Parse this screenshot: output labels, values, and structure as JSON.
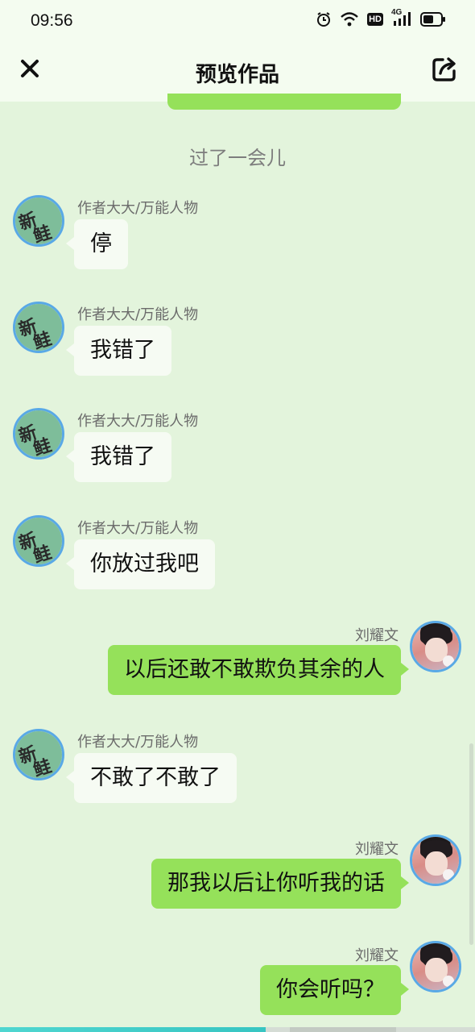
{
  "status_bar": {
    "time": "09:56",
    "icons": [
      "alarm-icon",
      "wifi-icon",
      "hd-icon",
      "signal-4g-icon",
      "battery-icon"
    ],
    "network_label": "4G",
    "hd_label": "HD"
  },
  "header": {
    "title": "预览作品",
    "close_icon": "close-icon",
    "share_icon": "share-icon"
  },
  "chat": {
    "time_divider": "过了一会儿",
    "avatar_glyphs": [
      "新",
      "鲑"
    ],
    "messages": [
      {
        "side": "left",
        "sender": "作者大大/万能人物",
        "text": "停"
      },
      {
        "side": "left",
        "sender": "作者大大/万能人物",
        "text": "我错了"
      },
      {
        "side": "left",
        "sender": "作者大大/万能人物",
        "text": "我错了"
      },
      {
        "side": "left",
        "sender": "作者大大/万能人物",
        "text": "你放过我吧"
      },
      {
        "side": "right",
        "sender": "刘耀文",
        "text": "以后还敢不敢欺负其余的人"
      },
      {
        "side": "left",
        "sender": "作者大大/万能人物",
        "text": "不敢了不敢了"
      },
      {
        "side": "right",
        "sender": "刘耀文",
        "text": "那我以后让你听我的话"
      },
      {
        "side": "right",
        "sender": "刘耀文",
        "text": "你会听吗？"
      }
    ]
  },
  "colors": {
    "background": "#e3f4dc",
    "header_background": "#f4fcf0",
    "bubble_right": "#95e15a",
    "bubble_left": "#f6fbf3",
    "avatar_border": "#59a9e6",
    "progress": "#37c5c2"
  },
  "playback_progress": 0.56
}
